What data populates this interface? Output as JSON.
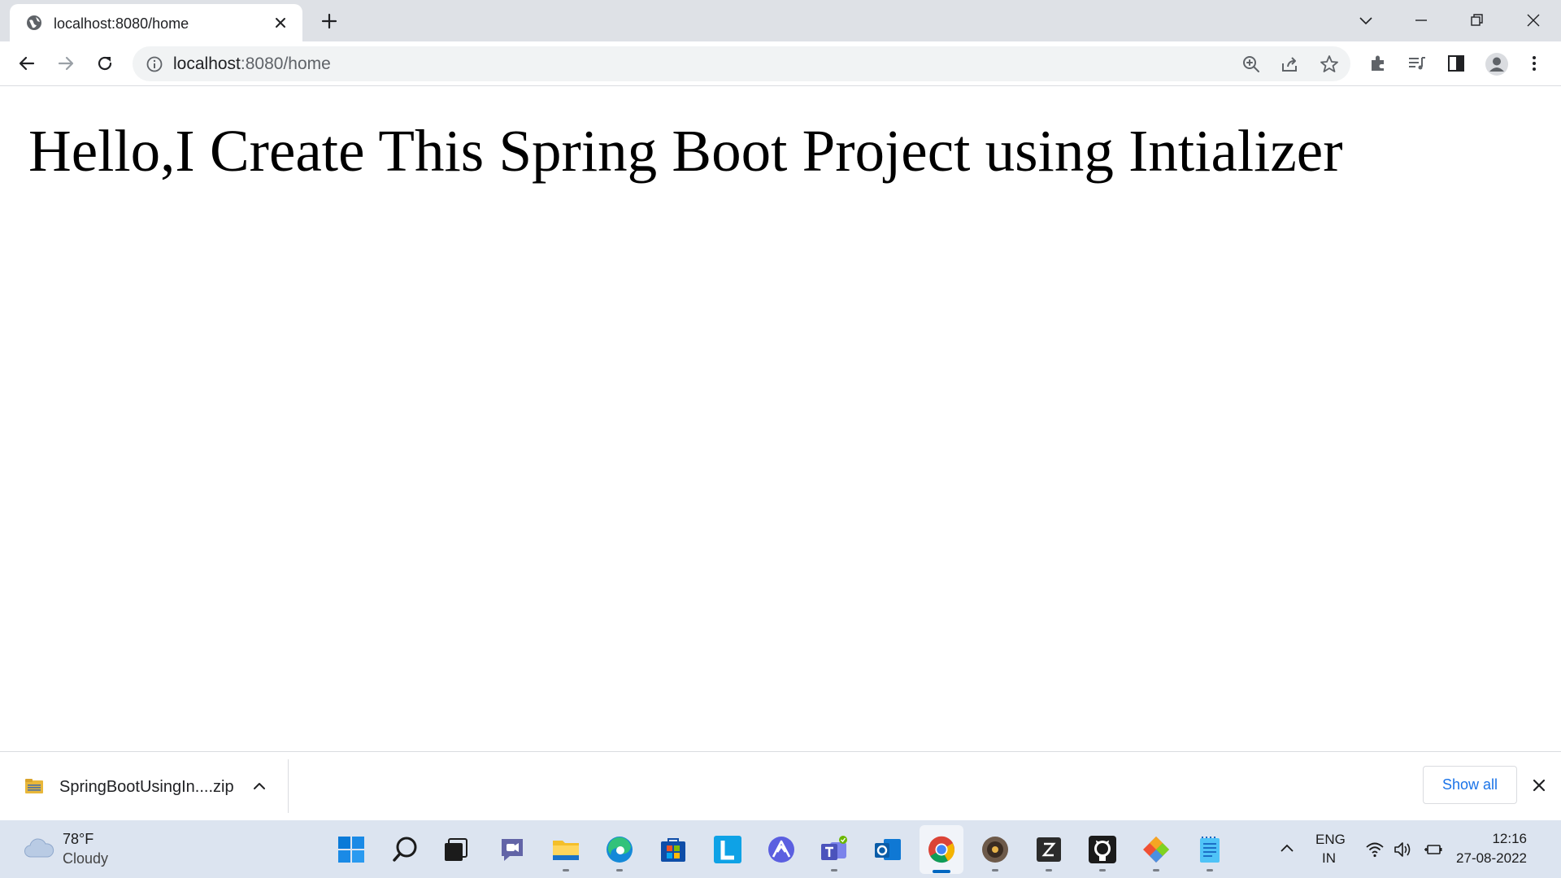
{
  "browser": {
    "tab": {
      "title": "localhost:8080/home",
      "favicon": "globe-icon"
    },
    "omnibox": {
      "host": "localhost",
      "path": ":8080/home"
    },
    "toolbar_icons": [
      "back-icon",
      "forward-icon",
      "reload-icon",
      "site-info-icon",
      "zoom-icon",
      "share-icon",
      "bookmark-star-icon",
      "extensions-icon",
      "reading-list-icon",
      "side-panel-icon",
      "profile-icon",
      "menu-icon"
    ]
  },
  "page": {
    "heading": "Hello,I Create This Spring Boot Project using Intializer"
  },
  "downloads": {
    "file_name": "SpringBootUsingIn....zip",
    "show_all_label": "Show all"
  },
  "taskbar": {
    "weather": {
      "temperature": "78°F",
      "condition": "Cloudy"
    },
    "apps": [
      "start",
      "search",
      "task-view",
      "chat",
      "file-explorer",
      "edge",
      "store",
      "lens",
      "app-a",
      "teams",
      "outlook",
      "chrome",
      "app-ide",
      "app-z",
      "github",
      "git",
      "notepad"
    ],
    "language": {
      "line1": "ENG",
      "line2": "IN"
    },
    "clock": {
      "time": "12:16",
      "date": "27-08-2022"
    }
  },
  "colors": {
    "tabstrip": "#dee1e6",
    "omnibox": "#f1f3f4",
    "link_blue": "#1a73e8",
    "taskbar": "#dce4f0",
    "active_indicator": "#0067c0"
  }
}
